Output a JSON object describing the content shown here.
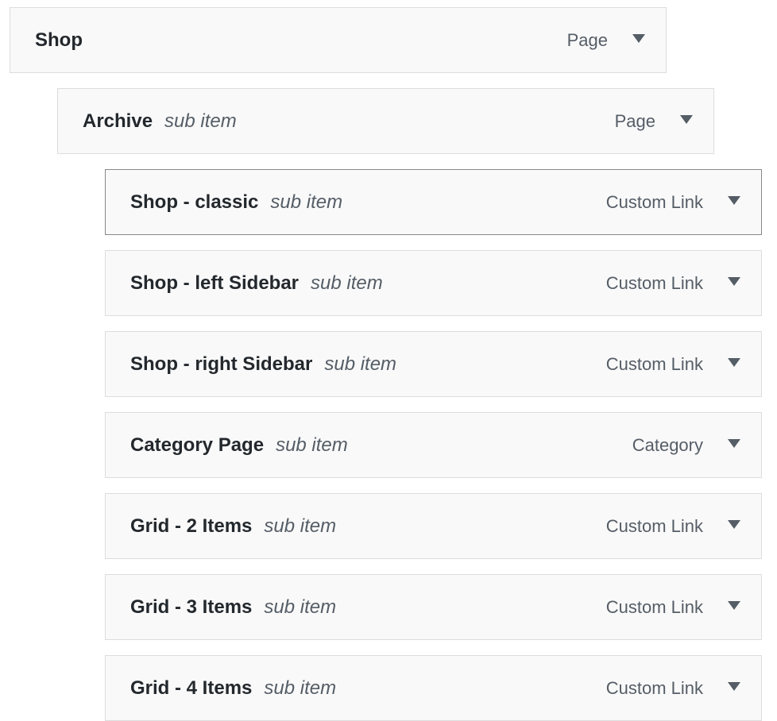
{
  "menu": {
    "items": [
      {
        "title": "Shop",
        "sub": "",
        "type": "Page",
        "depth": 0,
        "toggle_icon": "triangle-down-icon"
      },
      {
        "title": "Archive",
        "sub": "sub item",
        "type": "Page",
        "depth": 1,
        "toggle_icon": "triangle-down-icon"
      },
      {
        "title": "Shop - classic",
        "sub": "sub item",
        "type": "Custom Link",
        "depth": 2,
        "toggle_icon": "triangle-down-icon"
      },
      {
        "title": "Shop - left Sidebar",
        "sub": "sub item",
        "type": "Custom Link",
        "depth": 2,
        "toggle_icon": "triangle-down-icon"
      },
      {
        "title": "Shop - right Sidebar",
        "sub": "sub item",
        "type": "Custom Link",
        "depth": 2,
        "toggle_icon": "triangle-down-icon"
      },
      {
        "title": "Category Page",
        "sub": "sub item",
        "type": "Category",
        "depth": 2,
        "toggle_icon": "triangle-down-icon"
      },
      {
        "title": "Grid - 2 Items",
        "sub": "sub item",
        "type": "Custom Link",
        "depth": 2,
        "toggle_icon": "triangle-down-icon"
      },
      {
        "title": "Grid - 3 Items",
        "sub": "sub item",
        "type": "Custom Link",
        "depth": 2,
        "toggle_icon": "triangle-down-icon"
      },
      {
        "title": "Grid - 4 Items",
        "sub": "sub item",
        "type": "Custom Link",
        "depth": 2,
        "toggle_icon": "triangle-down-icon"
      }
    ]
  }
}
